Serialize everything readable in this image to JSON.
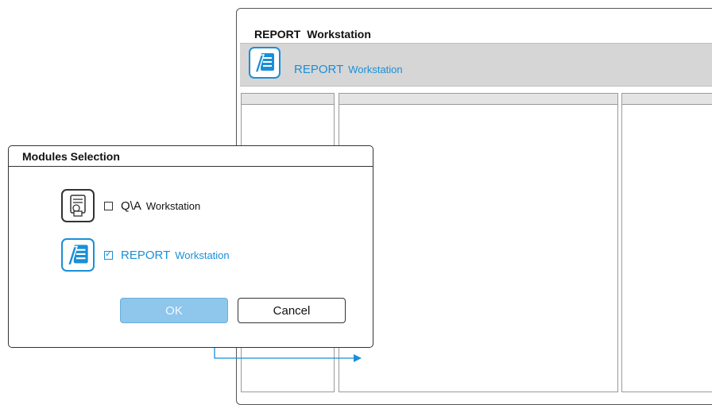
{
  "main_window": {
    "title": "REPORT   Workstation",
    "toolbar": {
      "app_name": "REPORT",
      "app_sub": "Workstation",
      "icon": "report-document-icon"
    }
  },
  "dialog": {
    "title": "Modules Selection",
    "modules": [
      {
        "name": "Q\\A",
        "sub": "Workstation",
        "checked": false,
        "icon": "qa-document-icon"
      },
      {
        "name": "REPORT",
        "sub": "Workstation",
        "checked": true,
        "icon": "report-document-icon"
      }
    ],
    "ok_label": "OK",
    "cancel_label": "Cancel"
  },
  "colors": {
    "accent": "#1a8fd8",
    "ok_button": "#8ec6ec",
    "toolbar_bg": "#d6d6d6"
  }
}
